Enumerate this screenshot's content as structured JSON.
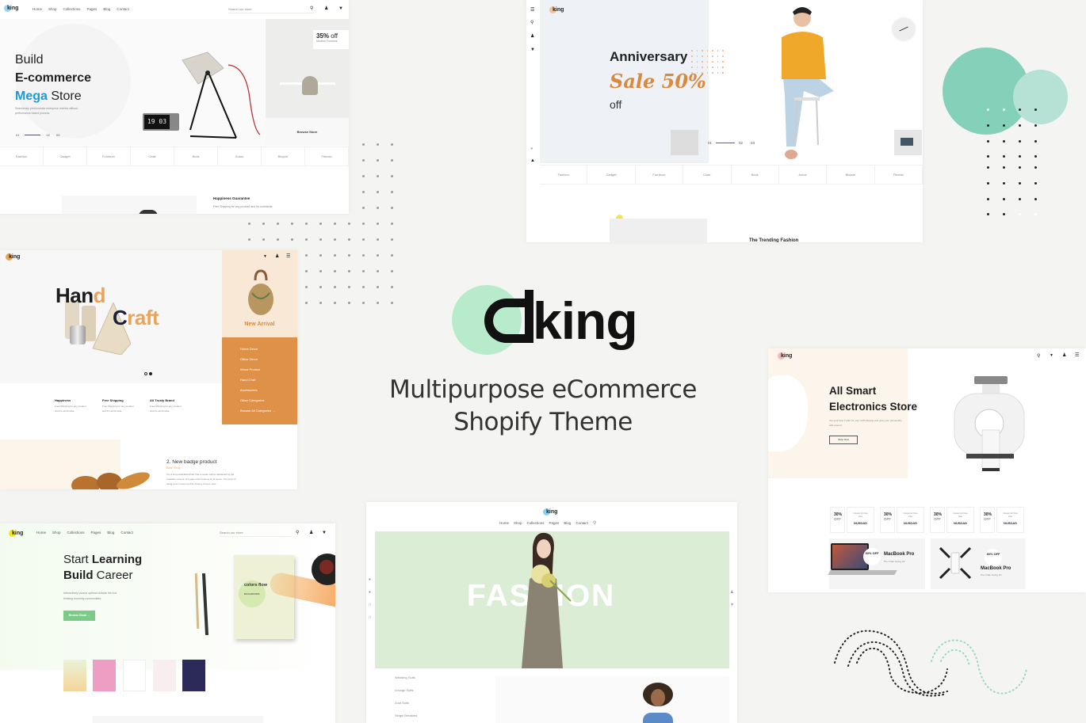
{
  "brand": {
    "name": "king",
    "tagline_line1": "Multipurpose eCommerce",
    "tagline_line2": "Shopify Theme",
    "accent_mint": "#b7ebcb"
  },
  "nav_common": [
    "Home",
    "Shop",
    "Collections",
    "Pages",
    "Blog",
    "Contact"
  ],
  "search_placeholder": "Search our store",
  "categories": [
    "Fashion",
    "Gadget",
    "Furniture",
    "Chair",
    "Book",
    "Autos",
    "Bicycle",
    "Fitness"
  ],
  "mega": {
    "logo": "king",
    "title_1": "Build",
    "title_2": "E-commerce",
    "title_3a": "Mega",
    "title_3b": "Store",
    "accent": "#1a9ad6",
    "desc": "Seamlessly predominate enterprise metrics without performance based process",
    "slides": [
      "01",
      "02",
      "03"
    ],
    "clock": "19 03",
    "promo_pct": "35%",
    "promo_off": "off",
    "promo_sub": "Modern Furniture",
    "browse": "Browse Store",
    "guarantee_title": "Happiness Guarantee",
    "guarantee_text": "Free Shipping for any product and it's worldwide"
  },
  "anniv": {
    "logo": "king",
    "title": "Anniversary",
    "sale": "Sale 50%",
    "off": "off",
    "accent": "#d98a3f",
    "slides": [
      "01",
      "02",
      "03"
    ],
    "trending": "The Trending Fashion"
  },
  "craft": {
    "logo": "king",
    "hand_a": "Han",
    "hand_b": "d",
    "craft_a": "C",
    "craft_b": "raft",
    "accent": "#e9a45a",
    "new_arrival": "New Arrival",
    "menu": [
      "Home Decor",
      "Office Decor",
      "Wood Product",
      "Hand Craft",
      "Accessories",
      "Other Categories",
      "Browse All Categories  →"
    ],
    "features": [
      {
        "title": "Happiness",
        "text": "Free Shipping for any product and it's world wide"
      },
      {
        "title": "Free Shipping",
        "text": "Free Shipping for any product and it's world wide"
      },
      {
        "title": "All Trusty Brand",
        "text": "Free Shipping for any product and it's world wide"
      }
    ],
    "badge_title": "2. New badge product",
    "badge_meta": "Bold · Drop",
    "badge_text": "It is a long established fact that a reader will be distracted by the readable content of a page when looking at its layout. The point of using Lorem Ipsum is that it has a more-or-less"
  },
  "learn": {
    "logo": "king",
    "title_1a": "Start",
    "title_1b": "Learning",
    "title_2a": "Build",
    "title_2b": "Career",
    "desc": "Interactively pursue optimal outside the box thinking enormity communities.",
    "button": "Browse Book  →",
    "accent": "#6fcf7e",
    "book_title": "colors flow",
    "book_sub": "BACKGROUNDS"
  },
  "fashion": {
    "logo": "king",
    "hero": "FASHION",
    "hero_bg": "#dcedd6",
    "side_menu": [
      "Wedding Suits",
      "Lounge Suits",
      "Zoot Suits",
      "Single Breasted"
    ]
  },
  "electro": {
    "logo": "king",
    "title_1": "All Smart",
    "title_2": "Electronics Store",
    "desc": "Get your best T-shirt for your outfit lifestyle and grow your personality with around",
    "button": "Shop Now",
    "coupons": [
      {
        "pct": "30%",
        "off": "OFF",
        "label": "Coupon for New User",
        "code": "NUSDAD"
      },
      {
        "pct": "30%",
        "off": "OFF",
        "label": "Coupon for New User",
        "code": "NUSDAD"
      },
      {
        "pct": "30%",
        "off": "OFF",
        "label": "Coupon for New User",
        "code": "NUSDAD"
      },
      {
        "pct": "30%",
        "off": "OFF",
        "label": "Coupon for New User",
        "code": "NUSDAD"
      }
    ],
    "promos": [
      {
        "badge": "30% OFF",
        "name": "MacBook Pro",
        "sub": "Pre Order Going On"
      },
      {
        "badge": "30% OFF",
        "name": "MacBook Pro",
        "sub": "Pre Order Going On"
      }
    ]
  }
}
